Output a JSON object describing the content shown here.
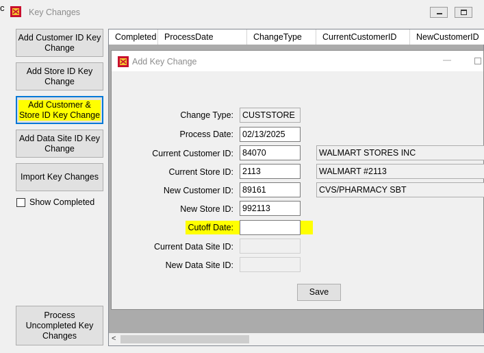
{
  "main_window": {
    "title": "Key Changes",
    "edge_char": "c"
  },
  "left_panel": {
    "buttons": [
      {
        "label": "Add Customer ID Key Change"
      },
      {
        "label": "Add Store ID Key Change"
      },
      {
        "label": "Add Customer & Store ID Key Change"
      },
      {
        "label": "Add Data Site ID Key Change"
      },
      {
        "label": "Import Key Changes"
      }
    ],
    "show_completed_label": "Show Completed",
    "process_button_label": "Process Uncompleted Key Changes"
  },
  "grid": {
    "columns": [
      "Completed",
      "ProcessDate",
      "ChangeType",
      "CurrentCustomerID",
      "NewCustomerID"
    ]
  },
  "dialog": {
    "title": "Add Key Change",
    "fields": {
      "change_type": {
        "label": "Change Type:",
        "value": "CUSTSTORE"
      },
      "process_date": {
        "label": "Process Date:",
        "value": "02/13/2025"
      },
      "current_customer_id": {
        "label": "Current Customer ID:",
        "value": "84070",
        "name": "WALMART STORES INC"
      },
      "current_store_id": {
        "label": "Current Store ID:",
        "value": "2113",
        "name": "WALMART #2113"
      },
      "new_customer_id": {
        "label": "New Customer ID:",
        "value": "89161",
        "name": "CVS/PHARMACY SBT"
      },
      "new_store_id": {
        "label": "New Store ID:",
        "value": "992113"
      },
      "cutoff_date": {
        "label": "Cutoff Date:",
        "value": ""
      },
      "current_data_site_id": {
        "label": "Current Data Site ID:",
        "value": ""
      },
      "new_data_site_id": {
        "label": "New Data Site ID:",
        "value": ""
      }
    },
    "save_label": "Save"
  },
  "colors": {
    "highlight": "#ffff00",
    "focus_border": "#0078d7"
  },
  "icons": [
    "app-icon",
    "minimize-icon",
    "maximize-icon",
    "checkbox-icon",
    "scroll-left-icon"
  ]
}
